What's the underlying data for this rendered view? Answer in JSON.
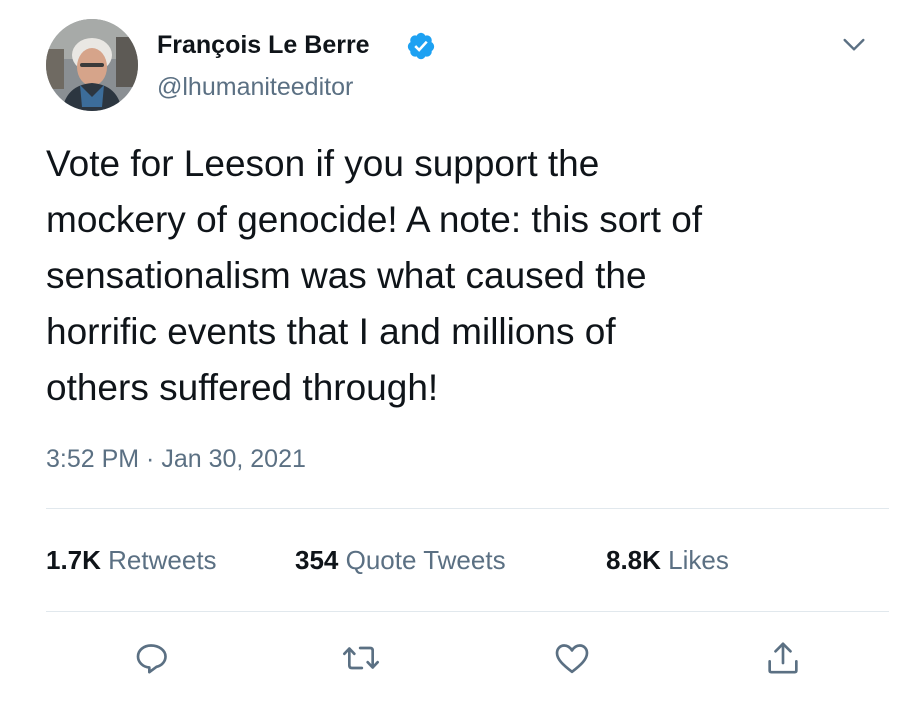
{
  "author": {
    "name": "François Le Berre",
    "handle": "@lhumaniteeditor",
    "verified": true
  },
  "tweet": {
    "text": "Vote for Leeson if you support the\nmockery of genocide! A note: this sort of\nsensationalism was what caused the\nhorrific events that I and millions of\nothers suffered through!",
    "timestamp": "3:52 PM · Jan 30, 2021"
  },
  "stats": {
    "retweets_count": "1.7K",
    "retweets_label": "Retweets",
    "quotes_count": "354",
    "quotes_label": "Quote Tweets",
    "likes_count": "8.8K",
    "likes_label": "Likes"
  },
  "icons": {
    "more": "chevron-down-icon",
    "reply": "reply-icon",
    "retweet": "retweet-icon",
    "like": "heart-icon",
    "share": "share-icon"
  },
  "colors": {
    "text": "#0f1419",
    "secondary": "#5b7083",
    "verified": "#1da1f2",
    "divider": "#e1e8ed"
  }
}
